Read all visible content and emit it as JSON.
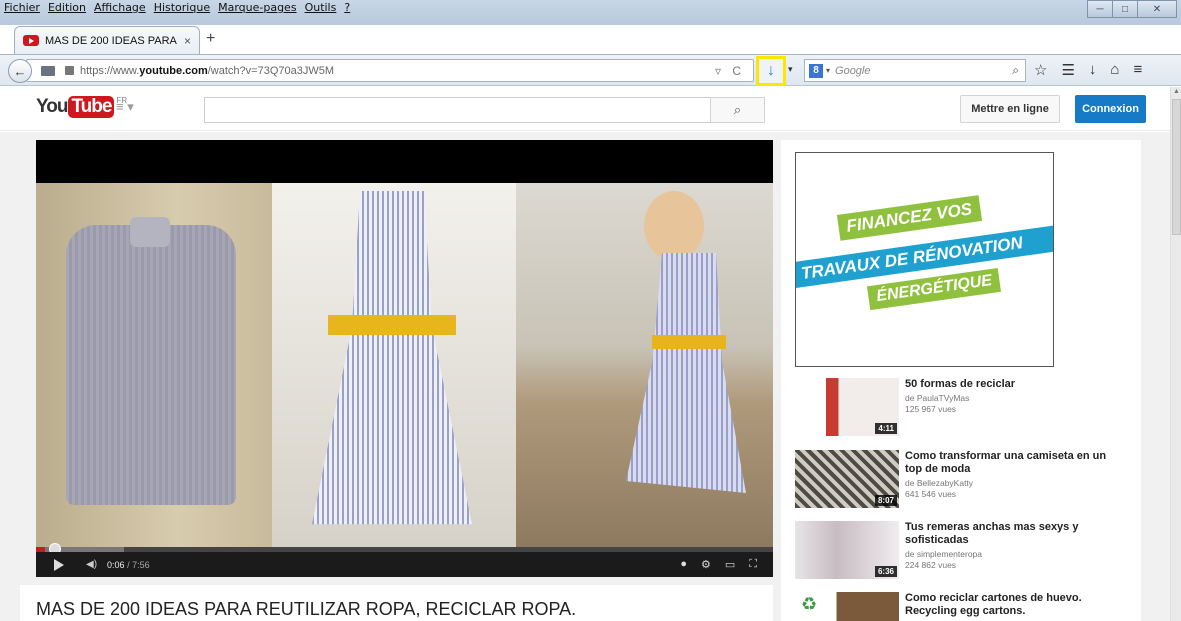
{
  "window": {
    "menu": [
      "Fichier",
      "Edition",
      "Affichage",
      "Historique",
      "Marque-pages",
      "Outils",
      "?"
    ],
    "controls": {
      "minimize": "─",
      "maximize": "□",
      "close": "✕"
    }
  },
  "tab": {
    "title": "MAS DE 200 IDEAS PARA R...",
    "close": "×",
    "new_tab": "+"
  },
  "navbar": {
    "back": "←",
    "url_prefix": "https://www.",
    "url_domain": "youtube.com",
    "url_path": "/watch?v=73Q70a3JW5M",
    "url_right": "▿ C",
    "download": "↓",
    "download_caret": "▾",
    "search_engine": "8",
    "search_caret": "▾",
    "search_placeholder": "Google",
    "search_icon": "⌕",
    "icons": [
      "☆",
      "☰",
      "↓",
      "⌂",
      "≡"
    ]
  },
  "youtube": {
    "logo_you": "You",
    "logo_tube": "Tube",
    "logo_region": "FR",
    "guide": "≡ ▾",
    "search_button": "⌕",
    "upload_label": "Mettre en ligne",
    "signin_label": "Connexion"
  },
  "player": {
    "current_time": "0:06",
    "duration": "/ 7:56",
    "progress_fraction": 0.0126,
    "buffer_fraction": 0.12,
    "volume_icon": "◀)",
    "right_icons": [
      "●",
      "⚙",
      "▭",
      "⛶"
    ]
  },
  "video": {
    "title": "MAS DE 200 IDEAS PARA REUTILIZAR ROPA, RECICLAR ROPA."
  },
  "ad": {
    "line1": "FINANCEZ VOS",
    "line2": "TRAVAUX DE RÉNOVATION",
    "line3": "ÉNERGÉTIQUE"
  },
  "recommendations": [
    {
      "title": "50 formas de reciclar",
      "channel": "de PaulaTVyMas",
      "views": "125 967 vues",
      "duration": "4:11"
    },
    {
      "title": "Como transformar una camiseta en un top de moda",
      "channel": "de BellezabyKatty",
      "views": "641 546 vues",
      "duration": "8:07"
    },
    {
      "title": "Tus remeras anchas mas sexys y sofisticadas",
      "channel": "de simplementeropa",
      "views": "224 862 vues",
      "duration": "6:36"
    },
    {
      "title": "Como reciclar cartones de huevo. Recycling egg cartons.",
      "channel": "",
      "views": "",
      "duration": ""
    }
  ],
  "colors": {
    "youtube_red": "#cc181e",
    "signin_blue": "#167ac6",
    "highlight_yellow": "#ffe600"
  }
}
